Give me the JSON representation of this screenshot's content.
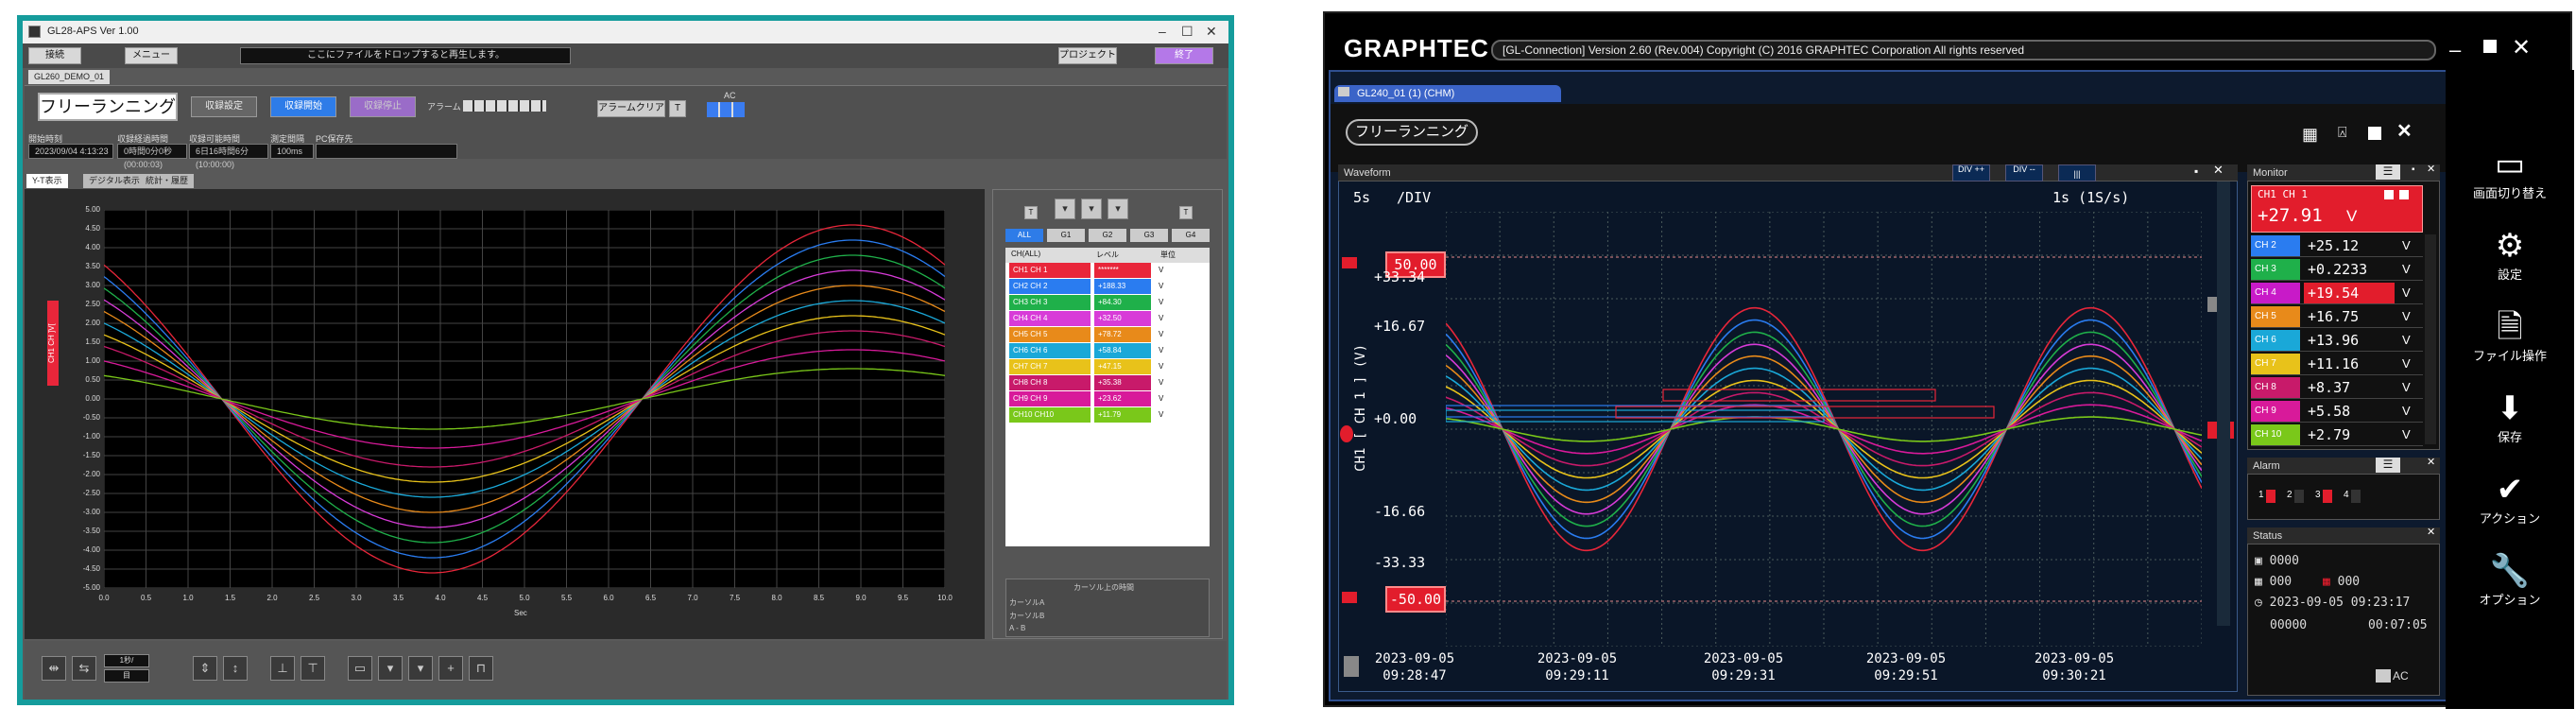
{
  "left": {
    "title": "GL28-APS Ver 1.00",
    "toolbar": {
      "b1": "接続",
      "b2": "メニュー",
      "message": "ここにファイルをドロップすると再生します。",
      "b3": "プロジェクト",
      "b4": "終了"
    },
    "file_tab": "GL260_DEMO_01",
    "mode_button": "フリーランニング",
    "buttons": {
      "record_settings": "収録設定",
      "start_record": "収録開始",
      "stop_record": "収録停止",
      "alarm_clear": "アラームクリア",
      "t": "T"
    },
    "alarm_label": "アラーム",
    "ac_label": "AC",
    "fields": [
      {
        "label": "開始時刻",
        "value": "2023/09/04 4:13:23"
      },
      {
        "label": "収録経過時間",
        "value": "0時間0分0秒(00:00:03)"
      },
      {
        "label": "収録可能時間",
        "value": "6日16時間6分(10:00:00)"
      },
      {
        "label": "測定間隔",
        "value": "100ms"
      },
      {
        "label": "PC保存先",
        "value": ""
      }
    ],
    "view_tabs": [
      "Y-T表示",
      "デジタル表示",
      "統計・履歴"
    ],
    "axis_side_label": "CH1 CH ]V[",
    "x_unit": "Sec",
    "yticks": [
      "5.00",
      "4.50",
      "4.00",
      "3.50",
      "3.00",
      "2.50",
      "2.00",
      "1.50",
      "1.00",
      "0.50",
      "0.00",
      "-0.50",
      "-1.00",
      "-1.50",
      "-2.00",
      "-2.50",
      "-3.00",
      "-3.50",
      "-4.00",
      "-4.50",
      "-5.00"
    ],
    "xticks": [
      "0.0",
      "0.5",
      "1.0",
      "1.5",
      "2.0",
      "2.5",
      "3.0",
      "3.5",
      "4.0",
      "4.5",
      "5.0",
      "5.5",
      "6.0",
      "6.5",
      "7.0",
      "7.5",
      "8.0",
      "8.5",
      "9.0",
      "9.5",
      "10.0"
    ],
    "group_tabs": [
      "ALL",
      "G1",
      "G2",
      "G3",
      "G4"
    ],
    "table_headers": [
      "CH(ALL)",
      "レベル",
      "単位"
    ],
    "channels": [
      {
        "name": "CH1 CH 1",
        "value": "*******",
        "unit": "V",
        "color": "#e8263a"
      },
      {
        "name": "CH2 CH 2",
        "value": "+188.33",
        "unit": "V",
        "color": "#2a7cf0"
      },
      {
        "name": "CH3 CH 3",
        "value": "+84.30",
        "unit": "V",
        "color": "#1fb04a"
      },
      {
        "name": "CH4 CH 4",
        "value": "+32.50",
        "unit": "V",
        "color": "#d83bd8"
      },
      {
        "name": "CH5 CH 5",
        "value": "+78.72",
        "unit": "V",
        "color": "#e88a1a"
      },
      {
        "name": "CH6 CH 6",
        "value": "+58.84",
        "unit": "V",
        "color": "#1aa8d8"
      },
      {
        "name": "CH7 CH 7",
        "value": "+47.15",
        "unit": "V",
        "color": "#e8c21a"
      },
      {
        "name": "CH8 CH 8",
        "value": "+35.38",
        "unit": "V",
        "color": "#c81a6a"
      },
      {
        "name": "CH9 CH 9",
        "value": "+23.62",
        "unit": "V",
        "color": "#d81a9a"
      },
      {
        "name": "CH10 CH10",
        "value": "+11.79",
        "unit": "V",
        "color": "#7ac81a"
      }
    ],
    "cursor_header": "カーソル上の時間",
    "cursor_rows": [
      "カーソルA",
      "カーソルB",
      "A - B"
    ],
    "bottom_time": "1秒/",
    "bottom_time2": "目"
  },
  "right": {
    "brand": "GRAPHTEC",
    "title": "[GL-Connection] Version 2.60 (Rev.004)  Copyright (C) 2016 GRAPHTEC Corporation All rights reserved",
    "tab": "GL240_01 (1) (CHM)",
    "mode_button": "フリーランニング",
    "waveform_label": "Waveform",
    "hdr_buttons": [
      "DIV ++",
      "DIV --",
      "|||"
    ],
    "time_div": "5s",
    "time_div_unit": "/DIV",
    "sample": "1s (1S/s)",
    "y_axis_label": "CH1 [ CH 1 ] (V)",
    "yticks": [
      "+33.34",
      "+16.67",
      "+0.00",
      "-16.66",
      "-33.33"
    ],
    "limit_top": "50.00",
    "limit_bottom": "-50.00",
    "xlabels": [
      {
        "date": "2023-09-05",
        "time": "09:28:47"
      },
      {
        "date": "2023-09-05",
        "time": "09:29:11"
      },
      {
        "date": "2023-09-05",
        "time": "09:29:31"
      },
      {
        "date": "2023-09-05",
        "time": "09:29:51"
      },
      {
        "date": "2023-09-05",
        "time": "09:30:21"
      }
    ],
    "monitor": {
      "label": "Monitor",
      "ch1_name": "CH1 CH 1",
      "ch1_value": "+27.91",
      "ch1_unit": "V",
      "rows": [
        {
          "ch": "CH 2",
          "value": "+25.12",
          "unit": "V",
          "color": "#2a7cf0"
        },
        {
          "ch": "CH 3",
          "value": "+0.2233",
          "unit": "V",
          "color": "#1fb04a"
        },
        {
          "ch": "CH 4",
          "value": "+19.54",
          "unit": "V",
          "color": "#c81ac8",
          "hl": true
        },
        {
          "ch": "CH 5",
          "value": "+16.75",
          "unit": "V",
          "color": "#e88a1a"
        },
        {
          "ch": "CH 6",
          "value": "+13.96",
          "unit": "V",
          "color": "#1aa8d8"
        },
        {
          "ch": "CH 7",
          "value": "+11.16",
          "unit": "V",
          "color": "#e8c21a"
        },
        {
          "ch": "CH 8",
          "value": "+8.37",
          "unit": "V",
          "color": "#c81a6a"
        },
        {
          "ch": "CH 9",
          "value": "+5.58",
          "unit": "V",
          "color": "#d81a9a"
        },
        {
          "ch": "CH 10",
          "value": "+2.79",
          "unit": "V",
          "color": "#7ac81a"
        }
      ]
    },
    "alarm": {
      "label": "Alarm",
      "items": [
        "1",
        "2",
        "3",
        "4"
      ]
    },
    "status": {
      "label": "Status",
      "v1": "0000",
      "v2": "000",
      "v3": "000",
      "date": "2023-09-05 09:23:17",
      "count": "00000",
      "elapsed": "00:07:05",
      "ac": "AC"
    },
    "side": [
      {
        "icon": "▭",
        "label": "画面切り替え"
      },
      {
        "icon": "⚙",
        "label": "設定"
      },
      {
        "icon": "🗎",
        "label": "ファイル操作"
      },
      {
        "icon": "⬇",
        "label": "保存"
      },
      {
        "icon": "✔",
        "label": "アクション"
      },
      {
        "icon": "🔧",
        "label": "オプション"
      }
    ]
  },
  "colors": {
    "left_frame": "#159c9c",
    "limit_red": "#e21d2c",
    "active_blue": "#2e7ce8"
  },
  "chart_data": [
    {
      "type": "line",
      "x": [
        0,
        10
      ],
      "xlabel": "Sec",
      "ylim": [
        -5,
        5
      ],
      "xlim": [
        0,
        10
      ],
      "series_note": "10 sine waves, period ≈ 10 s, crossing zero at 1.4 s and 6.4 s; amplitudes ~0.5 to 4.5 V"
    },
    {
      "type": "line",
      "ylim": [
        -50,
        50
      ],
      "series_note": "10 sine waves, period ≈ 40 s, amplitudes scaled per channel"
    }
  ]
}
